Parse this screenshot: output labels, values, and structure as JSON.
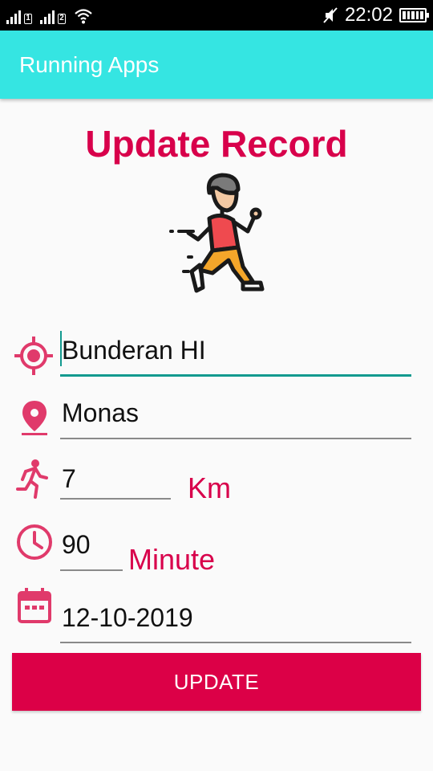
{
  "status_bar": {
    "time": "22:02",
    "sim1": "1",
    "sim2": "2"
  },
  "app_bar": {
    "title": "Running Apps"
  },
  "page": {
    "title": "Update Record"
  },
  "form": {
    "start_location": {
      "value": "Bunderan HI",
      "icon": "gps-target-icon"
    },
    "end_location": {
      "value": "Monas",
      "icon": "location-pin-icon"
    },
    "distance": {
      "value": "7",
      "unit": "Km",
      "icon": "running-person-icon"
    },
    "duration": {
      "value": "90",
      "unit": "Minute",
      "icon": "clock-icon"
    },
    "date": {
      "value": "12-10-2019",
      "icon": "calendar-icon"
    }
  },
  "actions": {
    "update_label": "UPDATE"
  },
  "colors": {
    "app_bar": "#35e5e2",
    "accent": "#d8004b",
    "button": "#dc0047",
    "focus_line": "#139a8f",
    "icon": "#e03a6b"
  }
}
